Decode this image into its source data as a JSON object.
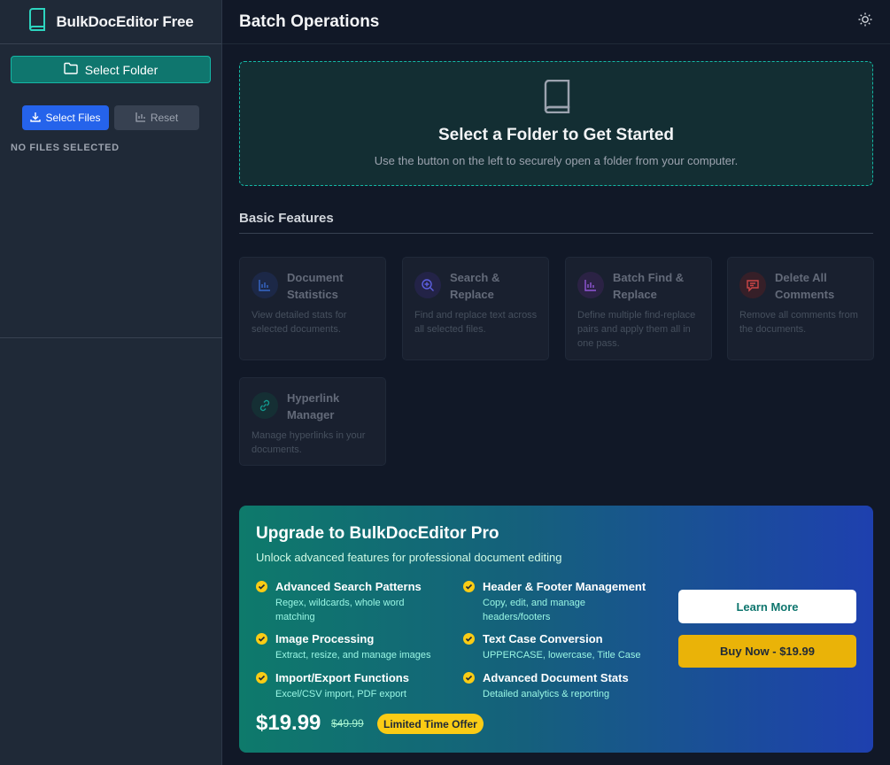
{
  "sidebar": {
    "app_title": "BulkDocEditor Free",
    "select_folder_label": "Select Folder",
    "select_files_label": "Select Files",
    "reset_label": "Reset",
    "no_files_text": "NO FILES SELECTED"
  },
  "header": {
    "title": "Batch Operations"
  },
  "dropzone": {
    "title": "Select a Folder to Get Started",
    "subtitle": "Use the button on the left to securely open a folder from your computer."
  },
  "features": {
    "section_title": "Basic Features",
    "cards": [
      {
        "title": "Document Statistics",
        "description": "View detailed stats for selected documents.",
        "icon": "bar-chart-icon",
        "accent": "#2563eb"
      },
      {
        "title": "Search & Replace",
        "description": "Find and replace text across all selected files.",
        "icon": "search-plus-icon",
        "accent": "#4f46e5"
      },
      {
        "title": "Batch Find & Replace",
        "description": "Define multiple find-replace pairs and apply them all in one pass.",
        "icon": "bar-chart-icon",
        "accent": "#9333ea"
      },
      {
        "title": "Delete All Comments",
        "description": "Remove all comments from the documents.",
        "icon": "comment-icon",
        "accent": "#dc2626"
      },
      {
        "title": "Hyperlink Manager",
        "description": "Manage hyperlinks in your documents.",
        "icon": "link-icon",
        "accent": "#0d9488"
      }
    ]
  },
  "promo": {
    "title": "Upgrade to BulkDocEditor Pro",
    "subtitle": "Unlock advanced features for professional document editing",
    "features": [
      {
        "title": "Advanced Search Patterns",
        "description": "Regex, wildcards, whole word matching"
      },
      {
        "title": "Header & Footer Management",
        "description": "Copy, edit, and manage headers/footers"
      },
      {
        "title": "Image Processing",
        "description": "Extract, resize, and manage images"
      },
      {
        "title": "Text Case Conversion",
        "description": "UPPERCASE, lowercase, Title Case"
      },
      {
        "title": "Import/Export Functions",
        "description": "Excel/CSV import, PDF export"
      },
      {
        "title": "Advanced Document Stats",
        "description": "Detailed analytics & reporting"
      }
    ],
    "price": "$19.99",
    "old_price": "$49.99",
    "badge": "Limited Time Offer",
    "learn_more_label": "Learn More",
    "buy_now_label": "Buy Now - $19.99"
  },
  "colors": {
    "accent_teal": "#14b8a6",
    "primary_blue": "#2563eb",
    "yellow": "#eab308"
  }
}
